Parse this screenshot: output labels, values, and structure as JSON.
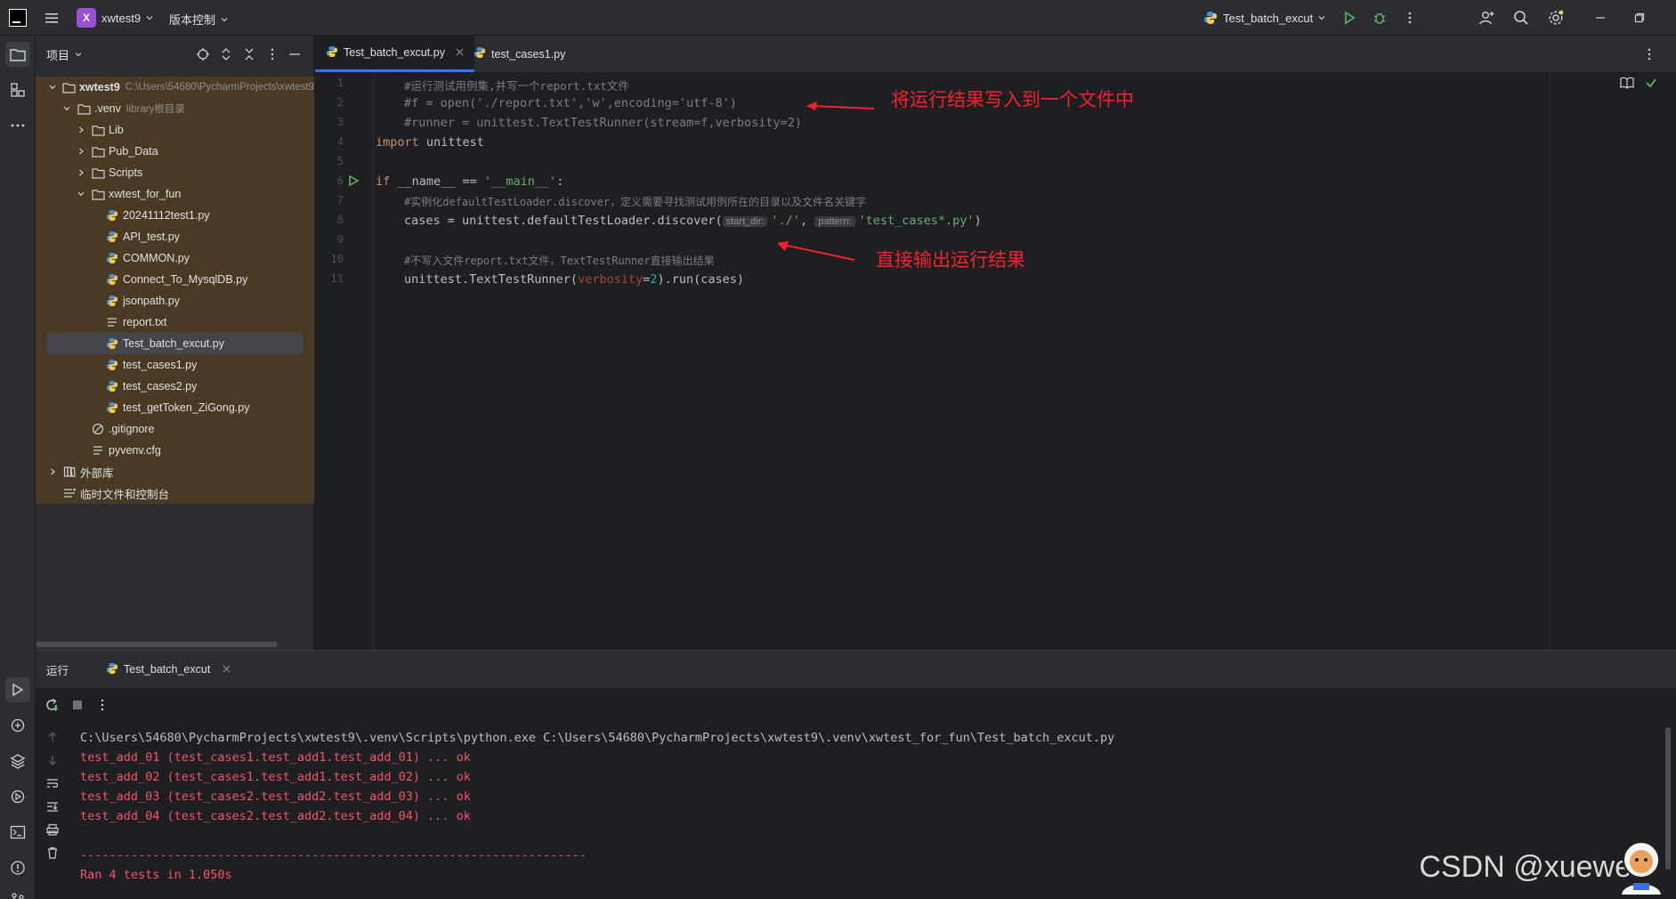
{
  "titlebar": {
    "project_initial": "X",
    "project_name": "xwtest9",
    "vcs_label": "版本控制",
    "run_config": "Test_batch_excut"
  },
  "project_pane": {
    "title": "项目",
    "root_name": "xwtest9",
    "root_path": "C:\\Users\\54680\\PycharmProjects\\xwtest9",
    "venv_name": ".venv",
    "venv_hint": "library根目录",
    "folders": [
      "Lib",
      "Pub_Data",
      "Scripts",
      "xwtest_for_fun"
    ],
    "files": [
      "20241112test1.py",
      "API_test.py",
      "COMMON.py",
      "Connect_To_MysqlDB.py",
      "jsonpath.py",
      "report.txt",
      "Test_batch_excut.py",
      "test_cases1.py",
      "test_cases2.py",
      "test_getToken_ZiGong.py"
    ],
    "venv_files": [
      ".gitignore",
      "pyvenv.cfg"
    ],
    "external_libs": "外部库",
    "scratches": "临时文件和控制台"
  },
  "tabs": [
    {
      "label": "Test_batch_excut.py",
      "active": true
    },
    {
      "label": "test_cases1.py",
      "active": false
    }
  ],
  "editor": {
    "line_numbers": [
      "1",
      "2",
      "3",
      "4",
      "5",
      "6",
      "7",
      "8",
      "9",
      "10",
      "11"
    ],
    "line1": "#运行测试用例集,并写一个report.txt文件",
    "line2": "#f = open('./report.txt','w',encoding='utf-8')",
    "line3": "#runner = unittest.TextTestRunner(stream=f,verbosity=2)",
    "line4_kw": "import",
    "line4_rest": " unittest",
    "line6_kw": "if",
    "line6_mid": " __name__ == ",
    "line6_str": "'__main__'",
    "line6_end": ":",
    "line7": "#实例化defaultTestLoader.discover，定义需要寻找测试用例所在的目录以及文件名关键字",
    "line8_a": "cases = unittest.defaultTestLoader.discover(",
    "line8_hint1": "start_dir:",
    "line8_s1": "'./'",
    "line8_comma": ", ",
    "line8_hint2": "pattern:",
    "line8_s2": "'test_cases*.py'",
    "line8_end": ")",
    "line10": "#不写入文件report.txt文件，TextTestRunner直接输出结果",
    "line11_a": "unittest.TextTestRunner(",
    "line11_param": "verbosity",
    "line11_eq": "=",
    "line11_num": "2",
    "line11_end": ").run(cases)",
    "annotation1": "将运行结果写入到一个文件中",
    "annotation2": "直接输出运行结果"
  },
  "run_panel": {
    "title": "运行",
    "tab_label": "Test_batch_excut",
    "command": "C:\\Users\\54680\\PycharmProjects\\xwtest9\\.venv\\Scripts\\python.exe C:\\Users\\54680\\PycharmProjects\\xwtest9\\.venv\\xwtest_for_fun\\Test_batch_excut.py",
    "output_lines": [
      "test_add_01 (test_cases1.test_add1.test_add_01) ... ok",
      "test_add_02 (test_cases1.test_add1.test_add_02) ... ok",
      "test_add_03 (test_cases2.test_add2.test_add_03) ... ok",
      "test_add_04 (test_cases2.test_add2.test_add_04) ... ok"
    ],
    "separator": "----------------------------------------------------------------------",
    "summary": "Ran 4 tests in 1.050s"
  },
  "watermark": "CSDN @xuewe",
  "colors": {
    "accent": "#3574f0",
    "annotation": "#f5222d",
    "output_red": "#f75464",
    "project_highlight": "#4a3a23"
  }
}
